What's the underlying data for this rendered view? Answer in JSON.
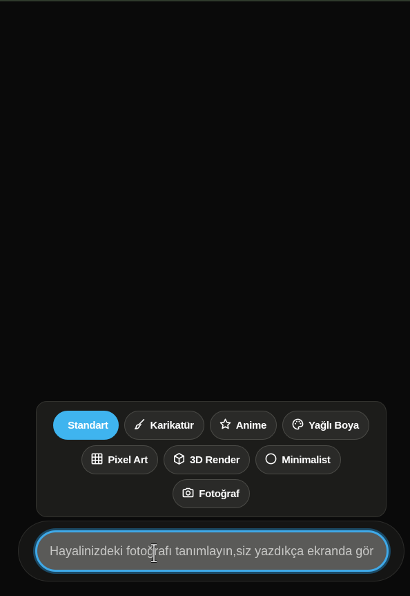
{
  "style_options": [
    {
      "label": "Standart",
      "icon": "none",
      "active": true
    },
    {
      "label": "Karikatür",
      "icon": "brush-icon",
      "active": false
    },
    {
      "label": "Anime",
      "icon": "star-icon",
      "active": false
    },
    {
      "label": "Yağlı Boya",
      "icon": "palette-icon",
      "active": false
    },
    {
      "label": "Pixel Art",
      "icon": "grid-icon",
      "active": false
    },
    {
      "label": "3D Render",
      "icon": "cube-icon",
      "active": false
    },
    {
      "label": "Minimalist",
      "icon": "circle-icon",
      "active": false
    },
    {
      "label": "Fotoğraf",
      "icon": "camera-icon",
      "active": false
    }
  ],
  "prompt": {
    "value": "",
    "placeholder": "Hayalinizdeki fotoğrafı tanımlayın,siz yazdıkça ekranda görünecek"
  },
  "colors": {
    "background": "#0a0a0a",
    "accent": "#3fb4ef",
    "chip": "#2a2a28"
  }
}
